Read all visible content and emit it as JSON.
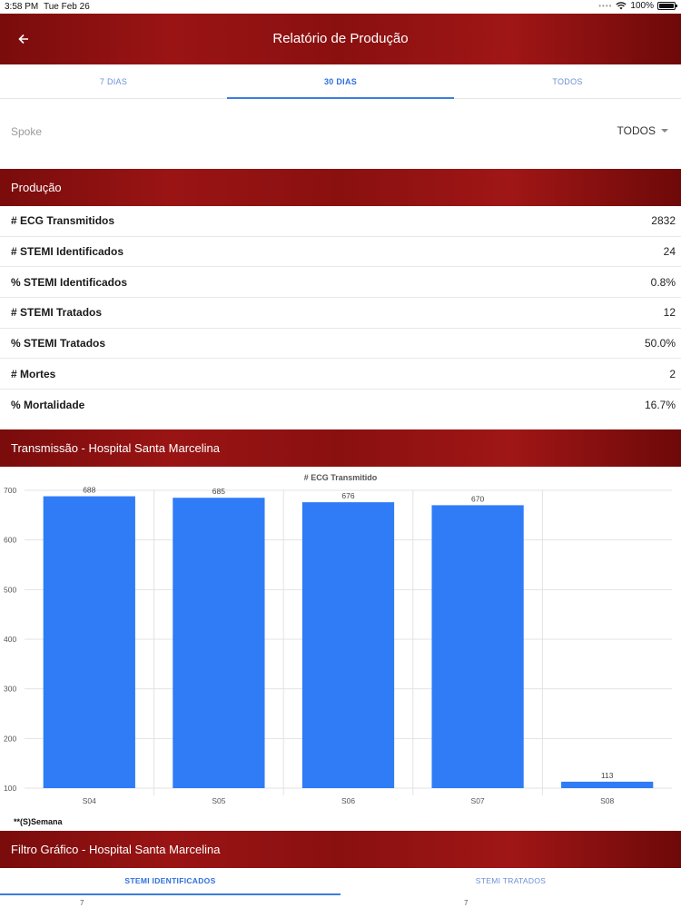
{
  "status_bar": {
    "time": "3:58 PM",
    "date": "Tue Feb 26",
    "battery": "100%"
  },
  "header": {
    "title": "Relatório de Produção",
    "back_icon": "arrow-left-icon"
  },
  "period_tabs": [
    {
      "label": "7 DIAS",
      "active": false
    },
    {
      "label": "30 DIAS",
      "active": true
    },
    {
      "label": "TODOS",
      "active": false
    }
  ],
  "filter": {
    "label": "Spoke",
    "value": "TODOS"
  },
  "producao": {
    "title": "Produção",
    "rows": [
      {
        "label": "# ECG Transmitidos",
        "value": "2832"
      },
      {
        "label": "# STEMI Identificados",
        "value": "24"
      },
      {
        "label": "% STEMI Identificados",
        "value": "0.8%"
      },
      {
        "label": "# STEMI Tratados",
        "value": "12"
      },
      {
        "label": "% STEMI Tratados",
        "value": "50.0%"
      },
      {
        "label": "# Mortes",
        "value": "2"
      },
      {
        "label": "% Mortalidade",
        "value": "16.7%"
      }
    ]
  },
  "transmissao": {
    "title": "Transmissão - Hospital Santa Marcelina",
    "note": "**(S)Semana"
  },
  "chart_data": {
    "type": "bar",
    "title": "# ECG Transmitido",
    "categories": [
      "S04",
      "S05",
      "S06",
      "S07",
      "S08"
    ],
    "values": [
      688,
      685,
      676,
      670,
      113
    ],
    "yticks": [
      100,
      200,
      300,
      400,
      500,
      600,
      700
    ],
    "ylim": [
      100,
      700
    ],
    "grid": true,
    "bar_color": "#2f7cf6"
  },
  "filtro": {
    "title": "Filtro Gráfico - Hospital Santa Marcelina",
    "tabs": [
      {
        "label": "STEMI IDENTIFICADOS",
        "active": true
      },
      {
        "label": "STEMI TRATADOS",
        "active": false
      }
    ],
    "peek_left": "7",
    "peek_right": "7"
  },
  "colors": {
    "header_red": "#8f1212",
    "tab_blue": "#2f6fe0",
    "bar_blue": "#2f7cf6"
  }
}
